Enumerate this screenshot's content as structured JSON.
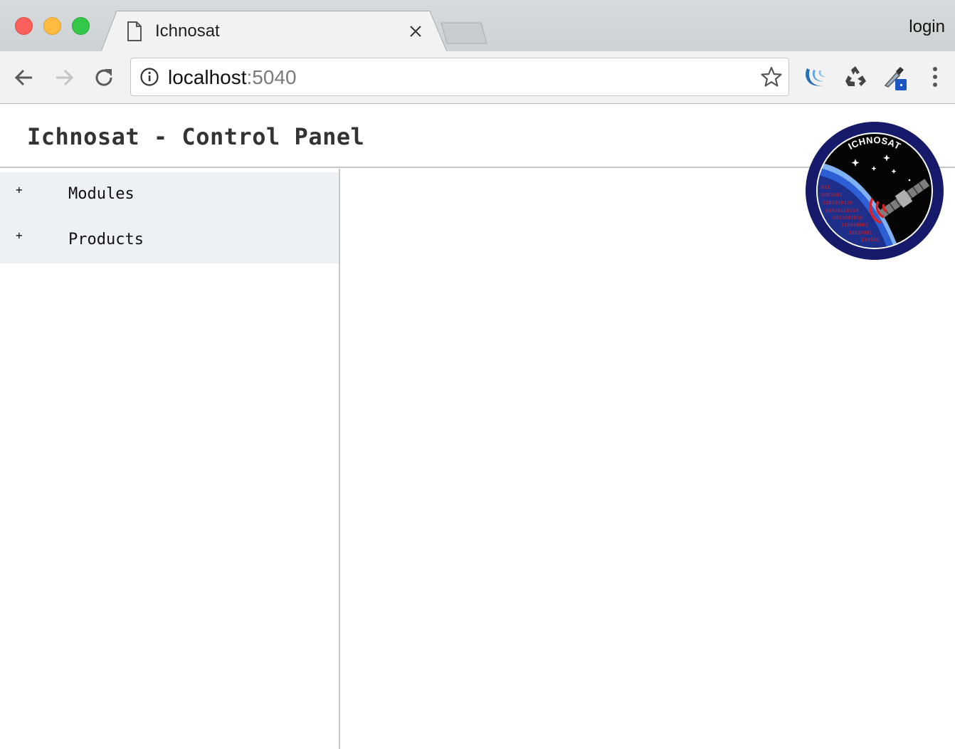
{
  "browser": {
    "tab_title": "Ichnosat",
    "profile_label": "login",
    "url_host": "localhost",
    "url_port": ":5040",
    "icons": {
      "back": "arrow-left-icon",
      "forward": "arrow-right-icon",
      "reload": "reload-icon",
      "info": "info-icon",
      "bookmark": "star-icon",
      "extensions": [
        "jquery-extension-icon",
        "recycle-extension-icon",
        "eyedropper-extension-icon"
      ],
      "menu": "three-dots-menu-icon"
    }
  },
  "app": {
    "title": "Ichnosat - Control Panel",
    "logo_text": "ICHNOSAT",
    "logo_binary": [
      "011",
      "0001001",
      "1101010110",
      "01010110110",
      "0011001010",
      "110010001",
      "10010001",
      "110101"
    ]
  },
  "sidebar": {
    "items": [
      {
        "expander": "+",
        "label": "Modules"
      },
      {
        "expander": "+",
        "label": "Products"
      }
    ]
  },
  "colors": {
    "sidebar_menu_bg": "#edf0f4",
    "chrome_bg": "#d6dadc",
    "toolbar_bg": "#f2f2f2",
    "logo_ring": "#151a6b",
    "logo_signal": "#e02020"
  }
}
